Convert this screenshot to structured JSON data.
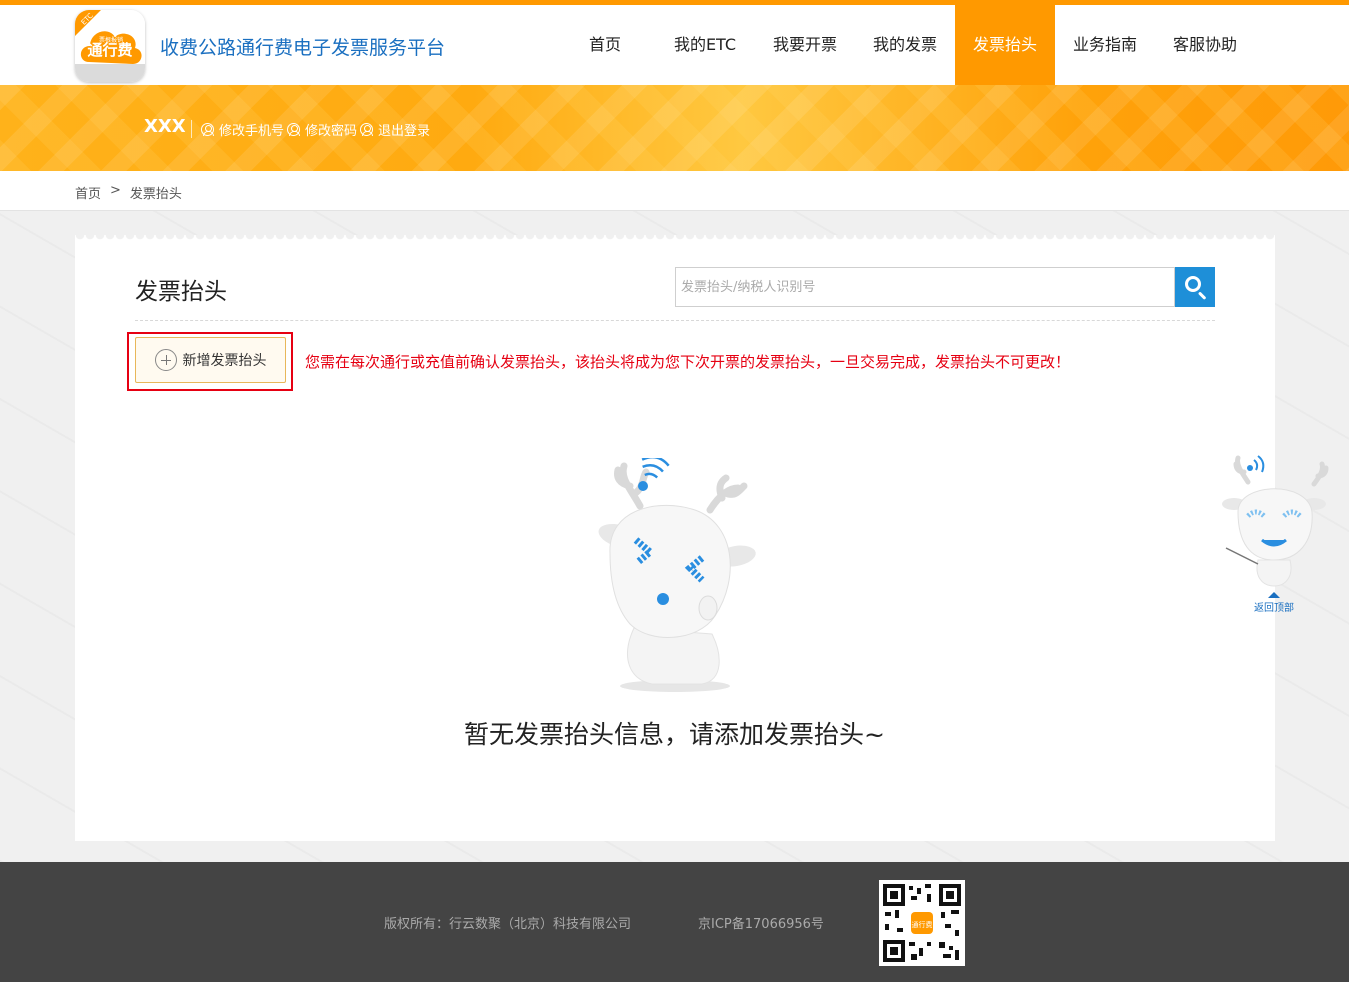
{
  "header": {
    "site_title": "收费公路通行费电子发票服务平台",
    "logo_text": "通行费",
    "logo_sub": "票根报销",
    "nav": [
      {
        "label": "首页",
        "active": false
      },
      {
        "label": "我的ETC",
        "active": false
      },
      {
        "label": "我要开票",
        "active": false
      },
      {
        "label": "我的发票",
        "active": false
      },
      {
        "label": "发票抬头",
        "active": true
      },
      {
        "label": "业务指南",
        "active": false
      },
      {
        "label": "客服协助",
        "active": false
      }
    ],
    "accent_color": "#ff9900"
  },
  "user_bar": {
    "user_name": "XXX",
    "links": [
      "修改手机号",
      "修改密码",
      "退出登录"
    ]
  },
  "breadcrumb": [
    "首页",
    ">",
    "发票抬头"
  ],
  "main": {
    "title": "发票抬头",
    "search_placeholder": "发票抬头/纳税人识别号",
    "add_button_label": "新增发票抬头",
    "warning": "您需在每次通行或充值前确认发票抬头，该抬头将成为您下次开票的发票抬头，一旦交易完成，发票抬头不可更改！",
    "empty_message": "暂无发票抬头信息，请添加发票抬头~"
  },
  "back_to_top_label": "返回顶部",
  "footer": {
    "copyright": "版权所有：行云数聚（北京）科技有限公司",
    "icp": "京ICP备17066956号"
  }
}
